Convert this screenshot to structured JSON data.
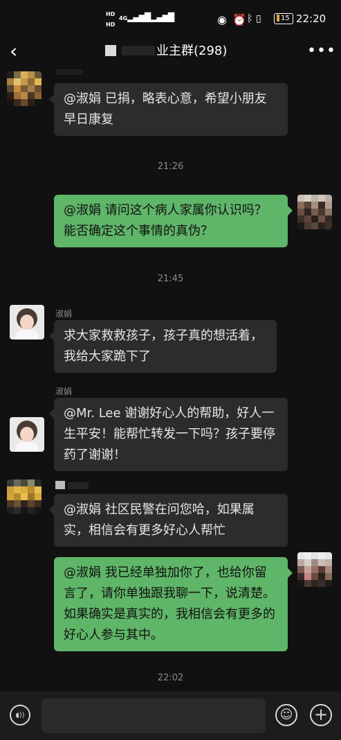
{
  "status_bar": {
    "hd1": "HD",
    "hd2": "HD",
    "net1": "4G",
    "net2": "4G",
    "battery": "15",
    "time": "22:20"
  },
  "header": {
    "title": "业主群(298)",
    "back_icon": "chevron-left-icon",
    "more_icon": "more-dots-icon",
    "more_label": "•••"
  },
  "messages": [
    {
      "type": "in",
      "sender": "",
      "text": "@淑娟  已捐，略表心意，希望小朋友早日康复"
    },
    {
      "type": "time",
      "text": "21:26"
    },
    {
      "type": "out",
      "text": "@淑娟  请问这个病人家属你认识吗？能否确定这个事情的真伪？"
    },
    {
      "type": "time",
      "text": "21:45"
    },
    {
      "type": "in",
      "sender": "淑娟",
      "text": "求大家救救孩子，孩子真的想活着，我给大家跪下了"
    },
    {
      "type": "in",
      "sender": "淑娟",
      "text": "@Mr. Lee 谢谢好心人的帮助，好人一生平安！能帮忙转发一下吗？孩子要停药了谢谢！"
    },
    {
      "type": "in",
      "sender": "",
      "text": "@淑娟  社区民警在问您哈，如果属实，相信会有更多好心人帮忙"
    },
    {
      "type": "out",
      "text": "@淑娟  我已经单独加你了，也给你留言了，请你单独跟我聊一下，说清楚。如果确实是真实的，我相信会有更多的好心人参与其中。"
    },
    {
      "type": "time",
      "text": "22:02"
    }
  ],
  "input_bar": {
    "voice_icon": "voice-icon",
    "emoji_icon": "emoji-icon",
    "plus_icon": "plus-icon",
    "voice_glyph": "◖))",
    "emoji_glyph": "☺",
    "plus_glyph": "+",
    "placeholder": ""
  }
}
